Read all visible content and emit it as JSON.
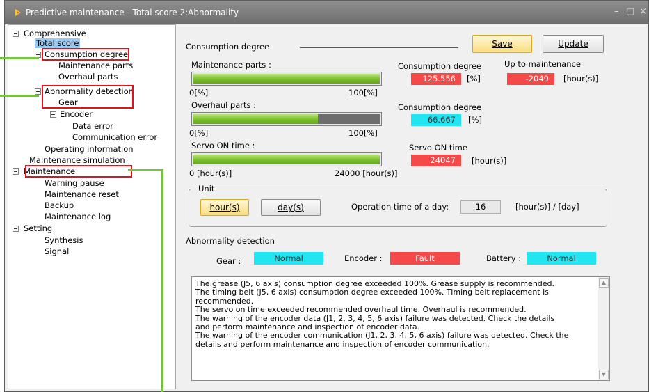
{
  "window": {
    "title": "Predictive maintenance - Total score 2:Abnormality",
    "controls": {
      "minimize": "–",
      "maximize": "□",
      "close": "×"
    }
  },
  "tree": {
    "comprehensive": "Comprehensive",
    "total_score": "Total score",
    "consumption_degree": "Consumption degree",
    "maintenance_parts": "Maintenance parts",
    "overhaul_parts": "Overhaul parts",
    "abnormality_detection": "Abnormality detection",
    "gear": "Gear",
    "encoder": "Encoder",
    "data_error": "Data error",
    "communication_error": "Communication error",
    "operating_information": "Operating information",
    "maintenance_simulation": "Maintenance simulation",
    "maintenance": "Maintenance",
    "warning_pause": "Warning pause",
    "maintenance_reset": "Maintenance reset",
    "backup": "Backup",
    "maintenance_log": "Maintenance log",
    "setting": "Setting",
    "synthesis": "Synthesis",
    "signal": "Signal"
  },
  "toolbar": {
    "save": "Save",
    "update": "Update"
  },
  "consumption": {
    "section_title": "Consumption degree",
    "maintenance_parts_label": "Maintenance parts :",
    "maintenance_parts_fill": 1.0,
    "bar_min": "0[%]",
    "bar_max": "100[%]",
    "overhaul_parts_label": "Overhaul parts :",
    "overhaul_parts_fill": 0.667,
    "servo_on_label": "Servo ON time :",
    "servo_on_fill": 1.0,
    "servo_min": "0 [hour(s)]",
    "servo_max": "24000 [hour(s)]",
    "consumption_degree_header_1": "Consumption degree",
    "consumption_degree_value_1": "125.556",
    "percent_unit_1": "[%]",
    "up_to_maintenance_header": "Up to maintenance",
    "up_to_maintenance_value": "-2049",
    "hour_unit_1": "[hour(s)]",
    "consumption_degree_header_2": "Consumption degree",
    "consumption_degree_value_2": "66.667",
    "percent_unit_2": "[%]",
    "servo_on_time_header": "Servo ON time",
    "servo_on_time_value": "24047",
    "hour_unit_2": "[hour(s)]"
  },
  "unit": {
    "legend": "Unit",
    "hours_button": "hour(s)",
    "days_button": "day(s)",
    "operation_time_label": "Operation time of a day:",
    "operation_time_value": "16",
    "operation_time_unit": "[hour(s)] / [day]"
  },
  "abnormality": {
    "section_title": "Abnormality detection",
    "gear_label": "Gear :",
    "gear_status": "Normal",
    "encoder_label": "Encoder :",
    "encoder_status": "Fault",
    "battery_label": "Battery :",
    "battery_status": "Normal"
  },
  "messages": {
    "text": "The grease (J5, 6 axis) consumption degree exceeded 100%. Grease supply is recommended.\nThe timing belt (J5, 6 axis) consumption degree exceeded 100%. Timing belt replacement is\nrecommended.\nThe servo on time exceeded recommended overhaul time. Overhaul is recommended.\nThe warning of the encoder data (J1, 2, 3, 4, 5, 6 axis) failure was detected. Check the details\nand perform maintenance and inspection of encoder data.\nThe warning of the encoder communication (J1, 2, 3, 4, 5, 6 axis) failure was detected. Check the\ndetails and perform maintenance and inspection of encoder communication."
  },
  "colors": {
    "fault": "#f54848",
    "normal": "#22e5f2",
    "highlight_box": "#e0141e",
    "callout_line": "#79c142"
  }
}
